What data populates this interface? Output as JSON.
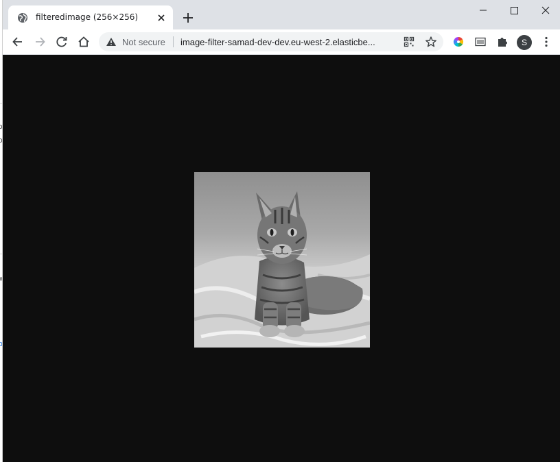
{
  "tab": {
    "title": "filteredimage (256×256)",
    "favicon": "globe-icon",
    "close_icon": "close-icon"
  },
  "new_tab_icon": "plus-icon",
  "window_controls": [
    "minimize-icon",
    "maximize-icon",
    "close-icon"
  ],
  "toolbar": {
    "back_icon": "arrow-left-icon",
    "forward_icon": "arrow-right-icon",
    "reload_icon": "reload-icon",
    "home_icon": "home-icon"
  },
  "omnibox": {
    "security_label": "Not secure",
    "security_icon": "warning-triangle-icon",
    "url": "image-filter-samad-dev-dev.eu-west-2.elasticbe...",
    "qr_icon": "qr-code-icon",
    "bookmark_icon": "star-icon"
  },
  "extensions": [
    "color-wheel-icon",
    "barcode-icon",
    "puzzle-icon"
  ],
  "profile": {
    "initial": "S"
  },
  "menu_icon": "kebab-menu-icon",
  "viewer": {
    "background": "#0e0e0e",
    "image_subject": "grayscale photo of a tabby cat lying on a blanket"
  },
  "colors": {
    "tabstrip": "#dee1e6",
    "omnibox": "#f1f3f4",
    "avatar": "#3c4043"
  }
}
